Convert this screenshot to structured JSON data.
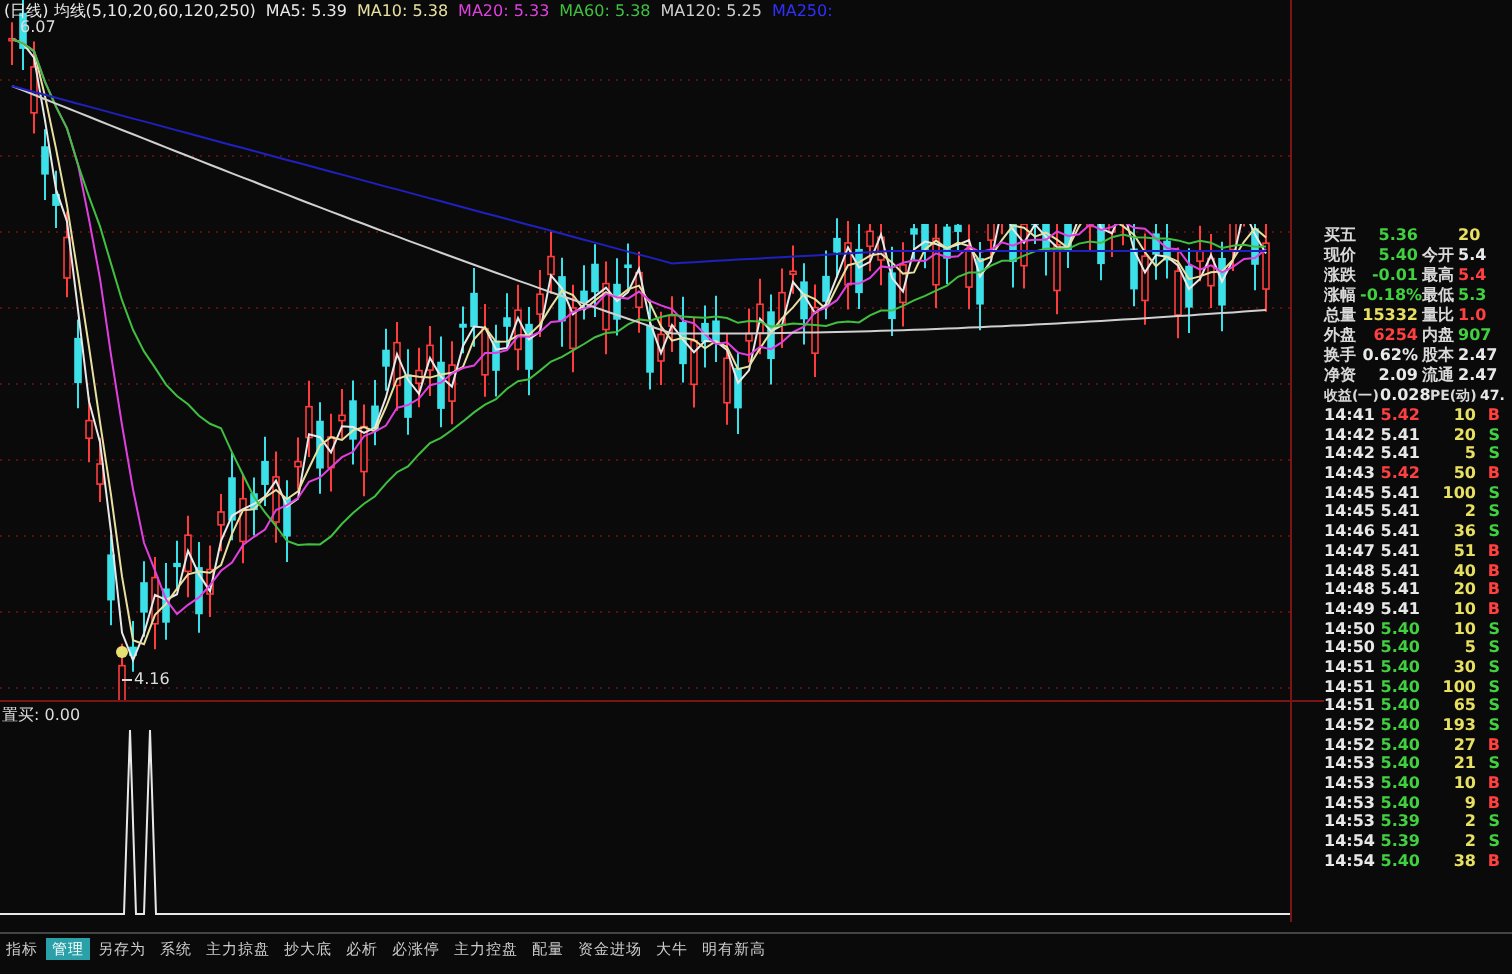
{
  "chart": {
    "title": "(日线) 均线(5,10,20,60,120,250)",
    "legend": [
      {
        "text": "MA5: 5.39",
        "color": "#e8e8e8"
      },
      {
        "text": "MA10: 5.38",
        "color": "#e8e0a0"
      },
      {
        "text": "MA20: 5.33",
        "color": "#e040e0"
      },
      {
        "text": "MA60: 5.38",
        "color": "#40c040"
      },
      {
        "text": "MA120: 5.25",
        "color": "#d0d0d0"
      },
      {
        "text": "MA250:",
        "color": "#3030ff"
      }
    ],
    "high_label": "6.07",
    "low_label": "4.16"
  },
  "indicator": {
    "label": "置买: 0.00"
  },
  "quote": [
    {
      "cells": [
        {
          "label": "买五",
          "value": "5.36",
          "color": "#40d040"
        },
        {
          "value": "20",
          "color": "#e8e060"
        }
      ]
    },
    {
      "cells": [
        {
          "label": "现价",
          "value": "5.40",
          "color": "#40d040"
        },
        {
          "label": "今开",
          "value": "5.4",
          "color": "#e8e8e8"
        }
      ]
    },
    {
      "cells": [
        {
          "label": "涨跌",
          "value": "-0.01",
          "color": "#40d040"
        },
        {
          "label": "最高",
          "value": "5.4",
          "color": "#ff4040"
        }
      ]
    },
    {
      "cells": [
        {
          "label": "涨幅",
          "value": "-0.18%",
          "color": "#40d040"
        },
        {
          "label": "最低",
          "value": "5.3",
          "color": "#40d040"
        }
      ]
    },
    {
      "cells": [
        {
          "label": "总量",
          "value": "15332",
          "color": "#e8e060"
        },
        {
          "label": "量比",
          "value": "1.0",
          "color": "#ff4040"
        }
      ]
    },
    {
      "cells": [
        {
          "label": "外盘",
          "value": "6254",
          "color": "#ff4040"
        },
        {
          "label": "内盘",
          "value": "907",
          "color": "#40d040"
        }
      ]
    },
    {
      "cells": [
        {
          "label": "换手",
          "value": "0.62%",
          "color": "#e8e8e8"
        },
        {
          "label": "股本",
          "value": "2.47",
          "color": "#e8e8e8"
        }
      ]
    },
    {
      "cells": [
        {
          "label": "净资",
          "value": "2.09",
          "color": "#e8e8e8"
        },
        {
          "label": "流通",
          "value": "2.47",
          "color": "#e8e8e8"
        }
      ]
    },
    {
      "cells": [
        {
          "label": "收益(一)",
          "value": "0.028",
          "color": "#e8e8e8"
        },
        {
          "label": "PE(动)",
          "value": "47.",
          "color": "#e8e8e8"
        }
      ]
    }
  ],
  "ticks": [
    {
      "time": "14:41",
      "price": {
        "text": "5.42",
        "color": "#ff4040"
      },
      "volume": "10",
      "flag": {
        "text": "B",
        "color": "#ff4040"
      }
    },
    {
      "time": "14:42",
      "price": {
        "text": "5.41",
        "color": "#e8e8e8"
      },
      "volume": "20",
      "flag": {
        "text": "S",
        "color": "#40d040"
      }
    },
    {
      "time": "14:42",
      "price": {
        "text": "5.41",
        "color": "#e8e8e8"
      },
      "volume": "5",
      "flag": {
        "text": "S",
        "color": "#40d040"
      }
    },
    {
      "time": "14:43",
      "price": {
        "text": "5.42",
        "color": "#ff4040"
      },
      "volume": "50",
      "flag": {
        "text": "B",
        "color": "#ff4040"
      }
    },
    {
      "time": "14:45",
      "price": {
        "text": "5.41",
        "color": "#e8e8e8"
      },
      "volume": "100",
      "flag": {
        "text": "S",
        "color": "#40d040"
      }
    },
    {
      "time": "14:45",
      "price": {
        "text": "5.41",
        "color": "#e8e8e8"
      },
      "volume": "2",
      "flag": {
        "text": "S",
        "color": "#40d040"
      }
    },
    {
      "time": "14:46",
      "price": {
        "text": "5.41",
        "color": "#e8e8e8"
      },
      "volume": "36",
      "flag": {
        "text": "S",
        "color": "#40d040"
      }
    },
    {
      "time": "14:47",
      "price": {
        "text": "5.41",
        "color": "#e8e8e8"
      },
      "volume": "51",
      "flag": {
        "text": "B",
        "color": "#ff4040"
      }
    },
    {
      "time": "14:48",
      "price": {
        "text": "5.41",
        "color": "#e8e8e8"
      },
      "volume": "40",
      "flag": {
        "text": "B",
        "color": "#ff4040"
      }
    },
    {
      "time": "14:48",
      "price": {
        "text": "5.41",
        "color": "#e8e8e8"
      },
      "volume": "20",
      "flag": {
        "text": "B",
        "color": "#ff4040"
      }
    },
    {
      "time": "14:49",
      "price": {
        "text": "5.41",
        "color": "#e8e8e8"
      },
      "volume": "10",
      "flag": {
        "text": "B",
        "color": "#ff4040"
      }
    },
    {
      "time": "14:50",
      "price": {
        "text": "5.40",
        "color": "#40d040"
      },
      "volume": "10",
      "flag": {
        "text": "S",
        "color": "#40d040"
      }
    },
    {
      "time": "14:50",
      "price": {
        "text": "5.40",
        "color": "#40d040"
      },
      "volume": "5",
      "flag": {
        "text": "S",
        "color": "#40d040"
      }
    },
    {
      "time": "14:51",
      "price": {
        "text": "5.40",
        "color": "#40d040"
      },
      "volume": "30",
      "flag": {
        "text": "S",
        "color": "#40d040"
      }
    },
    {
      "time": "14:51",
      "price": {
        "text": "5.40",
        "color": "#40d040"
      },
      "volume": "100",
      "flag": {
        "text": "S",
        "color": "#40d040"
      }
    },
    {
      "time": "14:51",
      "price": {
        "text": "5.40",
        "color": "#40d040"
      },
      "volume": "65",
      "flag": {
        "text": "S",
        "color": "#40d040"
      }
    },
    {
      "time": "14:52",
      "price": {
        "text": "5.40",
        "color": "#40d040"
      },
      "volume": "193",
      "flag": {
        "text": "S",
        "color": "#40d040"
      }
    },
    {
      "time": "14:52",
      "price": {
        "text": "5.40",
        "color": "#40d040"
      },
      "volume": "27",
      "flag": {
        "text": "B",
        "color": "#ff4040"
      }
    },
    {
      "time": "14:53",
      "price": {
        "text": "5.40",
        "color": "#40d040"
      },
      "volume": "21",
      "flag": {
        "text": "S",
        "color": "#40d040"
      }
    },
    {
      "time": "14:53",
      "price": {
        "text": "5.40",
        "color": "#40d040"
      },
      "volume": "10",
      "flag": {
        "text": "B",
        "color": "#ff4040"
      }
    },
    {
      "time": "14:53",
      "price": {
        "text": "5.40",
        "color": "#40d040"
      },
      "volume": "9",
      "flag": {
        "text": "B",
        "color": "#ff4040"
      }
    },
    {
      "time": "14:53",
      "price": {
        "text": "5.39",
        "color": "#40d040"
      },
      "volume": "2",
      "flag": {
        "text": "S",
        "color": "#40d040"
      }
    },
    {
      "time": "14:54",
      "price": {
        "text": "5.39",
        "color": "#40d040"
      },
      "volume": "2",
      "flag": {
        "text": "S",
        "color": "#40d040"
      }
    },
    {
      "time": "14:54",
      "price": {
        "text": "5.40",
        "color": "#40d040"
      },
      "volume": "38",
      "flag": {
        "text": "B",
        "color": "#ff4040"
      }
    }
  ],
  "tabs": [
    {
      "label": "指标",
      "selected": false
    },
    {
      "label": "管理",
      "selected": true
    },
    {
      "label": "另存为",
      "selected": false
    },
    {
      "label": "系统",
      "selected": false
    },
    {
      "label": "主力掠盘",
      "selected": false
    },
    {
      "label": "抄大底",
      "selected": false
    },
    {
      "label": "必析",
      "selected": false
    },
    {
      "label": "必涨停",
      "selected": false
    },
    {
      "label": "主力控盘",
      "selected": false
    },
    {
      "label": "配量",
      "selected": false
    },
    {
      "label": "资金进场",
      "selected": false
    },
    {
      "label": "大牛",
      "selected": false
    },
    {
      "label": "明有新高",
      "selected": false
    }
  ]
}
